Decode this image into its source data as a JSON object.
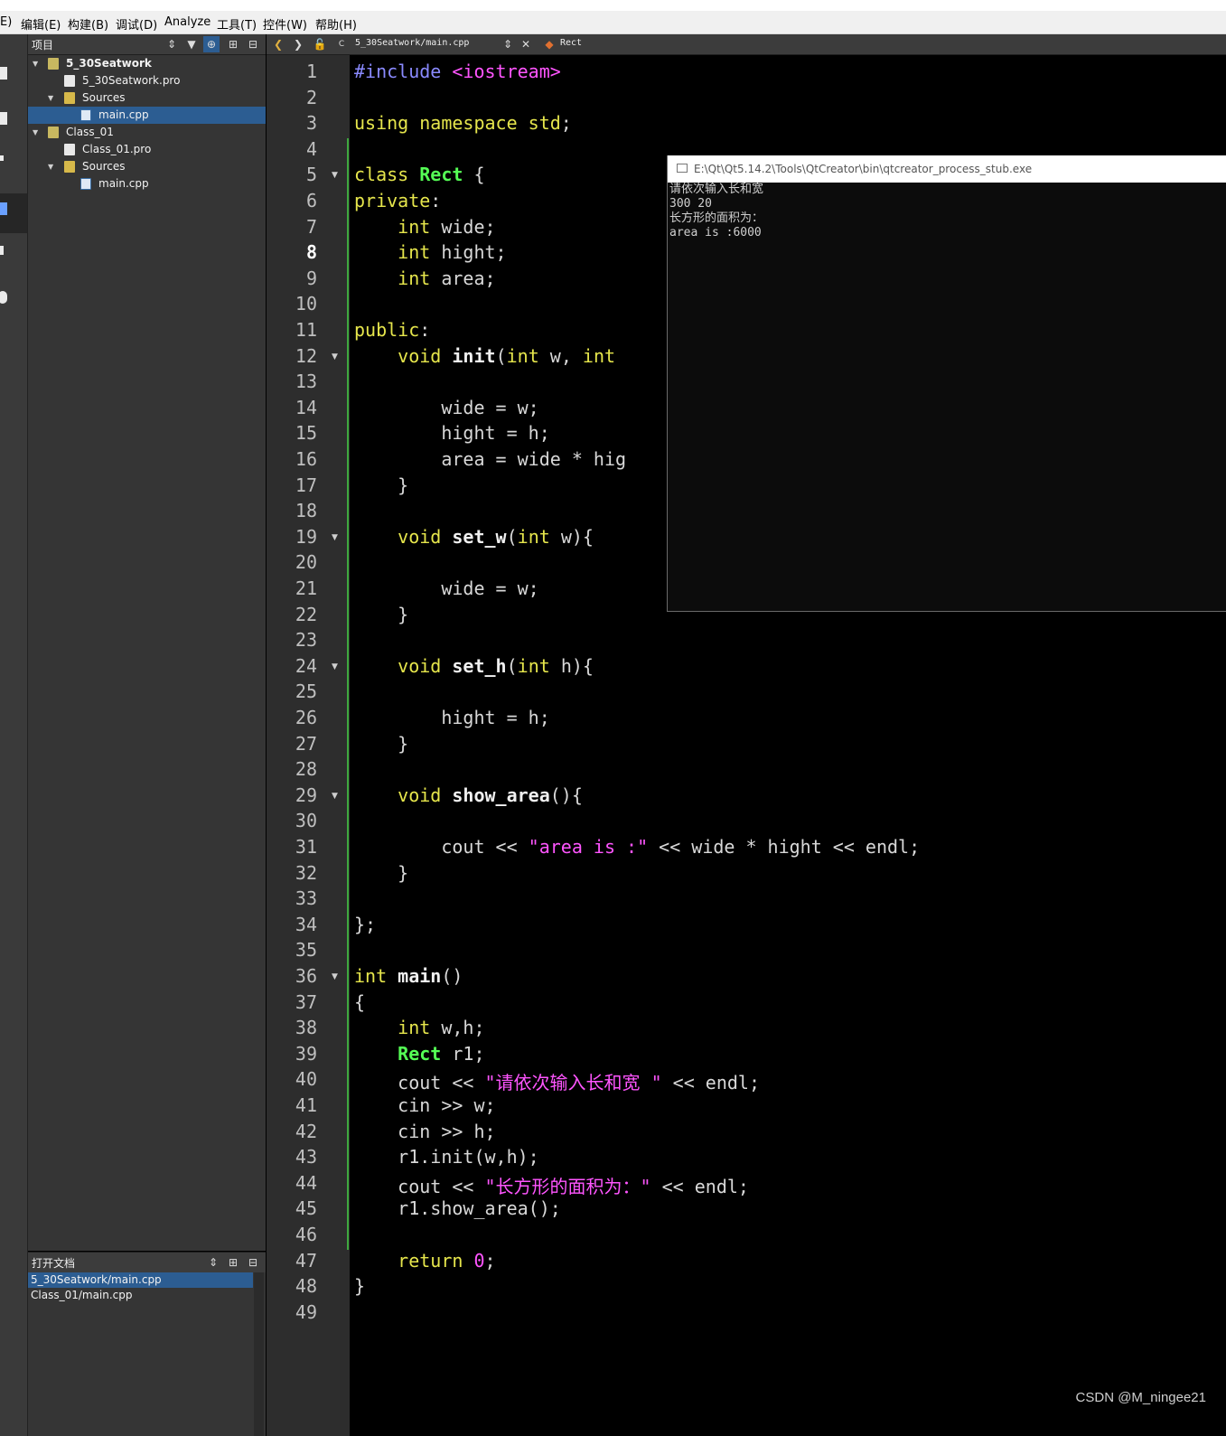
{
  "menu": [
    "编辑(E)",
    "构建(B)",
    "调试(D)",
    "Analyze",
    "工具(T)",
    "控件(W)",
    "帮助(H)"
  ],
  "menu_partial": "E)",
  "project_panel": {
    "title": "项目",
    "tree": [
      {
        "label": "5_30Seatwork",
        "kind": "project",
        "depth": 0,
        "expanded": true,
        "bold": true
      },
      {
        "label": "5_30Seatwork.pro",
        "kind": "pro",
        "depth": 1
      },
      {
        "label": "Sources",
        "kind": "folder",
        "depth": 1,
        "expanded": true
      },
      {
        "label": "main.cpp",
        "kind": "cpp",
        "depth": 2,
        "selected": true
      },
      {
        "label": "Class_01",
        "kind": "project",
        "depth": 0,
        "expanded": true
      },
      {
        "label": "Class_01.pro",
        "kind": "pro",
        "depth": 1
      },
      {
        "label": "Sources",
        "kind": "folder",
        "depth": 1,
        "expanded": true
      },
      {
        "label": "main.cpp",
        "kind": "cpp",
        "depth": 2
      }
    ]
  },
  "open_docs": {
    "title": "打开文档",
    "items": [
      {
        "label": "5_30Seatwork/main.cpp",
        "selected": true
      },
      {
        "label": "Class_01/main.cpp"
      }
    ]
  },
  "editor": {
    "file_combo": "5_30Seatwork/main.cpp",
    "symbol": "Rect",
    "current_line": 8,
    "lines": [
      [
        {
          "t": "#include ",
          "c": "pp"
        },
        {
          "t": "<iostream>",
          "c": "inc"
        }
      ],
      [],
      [
        {
          "t": "using ",
          "c": "kw"
        },
        {
          "t": "namespace ",
          "c": "kw"
        },
        {
          "t": "std",
          "c": "kw"
        },
        {
          "t": ";"
        }
      ],
      [],
      [
        {
          "t": "class ",
          "c": "kw"
        },
        {
          "t": "Rect",
          "c": "ty"
        },
        {
          "t": " {"
        }
      ],
      [
        {
          "t": "private",
          "c": "kw"
        },
        {
          "t": ":"
        }
      ],
      [
        {
          "t": "    "
        },
        {
          "t": "int",
          "c": "kw"
        },
        {
          "t": " wide;"
        }
      ],
      [
        {
          "t": "    "
        },
        {
          "t": "int",
          "c": "kw"
        },
        {
          "t": " hight;"
        }
      ],
      [
        {
          "t": "    "
        },
        {
          "t": "int",
          "c": "kw"
        },
        {
          "t": " area;"
        }
      ],
      [],
      [
        {
          "t": "public",
          "c": "kw"
        },
        {
          "t": ":"
        }
      ],
      [
        {
          "t": "    "
        },
        {
          "t": "void",
          "c": "kw"
        },
        {
          "t": " "
        },
        {
          "t": "init",
          "c": "fn"
        },
        {
          "t": "("
        },
        {
          "t": "int",
          "c": "kw"
        },
        {
          "t": " w, "
        },
        {
          "t": "int",
          "c": "kw"
        }
      ],
      [],
      [
        {
          "t": "        wide = w;"
        }
      ],
      [
        {
          "t": "        hight = h;"
        }
      ],
      [
        {
          "t": "        area = wide * hig"
        }
      ],
      [
        {
          "t": "    }"
        }
      ],
      [],
      [
        {
          "t": "    "
        },
        {
          "t": "void",
          "c": "kw"
        },
        {
          "t": " "
        },
        {
          "t": "set_w",
          "c": "fn"
        },
        {
          "t": "("
        },
        {
          "t": "int",
          "c": "kw"
        },
        {
          "t": " w){"
        }
      ],
      [],
      [
        {
          "t": "        wide = w;"
        }
      ],
      [
        {
          "t": "    }"
        }
      ],
      [],
      [
        {
          "t": "    "
        },
        {
          "t": "void",
          "c": "kw"
        },
        {
          "t": " "
        },
        {
          "t": "set_h",
          "c": "fn"
        },
        {
          "t": "("
        },
        {
          "t": "int",
          "c": "kw"
        },
        {
          "t": " h){"
        }
      ],
      [],
      [
        {
          "t": "        hight = h;"
        }
      ],
      [
        {
          "t": "    }"
        }
      ],
      [],
      [
        {
          "t": "    "
        },
        {
          "t": "void",
          "c": "kw"
        },
        {
          "t": " "
        },
        {
          "t": "show_area",
          "c": "fn"
        },
        {
          "t": "(){"
        }
      ],
      [],
      [
        {
          "t": "        cout << "
        },
        {
          "t": "\"area is :\"",
          "c": "st"
        },
        {
          "t": " << wide * hight << endl;"
        }
      ],
      [
        {
          "t": "    }"
        }
      ],
      [],
      [
        {
          "t": "};"
        }
      ],
      [],
      [
        {
          "t": "int",
          "c": "kw"
        },
        {
          "t": " "
        },
        {
          "t": "main",
          "c": "fn"
        },
        {
          "t": "()"
        }
      ],
      [
        {
          "t": "{"
        }
      ],
      [
        {
          "t": "    "
        },
        {
          "t": "int",
          "c": "kw"
        },
        {
          "t": " w,h;"
        }
      ],
      [
        {
          "t": "    "
        },
        {
          "t": "Rect",
          "c": "ty"
        },
        {
          "t": " r1;"
        }
      ],
      [
        {
          "t": "    cout << "
        },
        {
          "t": "\"请依次输入长和宽 \"",
          "c": "st"
        },
        {
          "t": " << endl;"
        }
      ],
      [
        {
          "t": "    cin >> w;"
        }
      ],
      [
        {
          "t": "    cin >> h;"
        }
      ],
      [
        {
          "t": "    r1.init(w,h);"
        }
      ],
      [
        {
          "t": "    cout << "
        },
        {
          "t": "\"长方形的面积为：\"",
          "c": "st"
        },
        {
          "t": " << endl;"
        }
      ],
      [
        {
          "t": "    r1.show_area();"
        }
      ],
      [],
      [
        {
          "t": "    "
        },
        {
          "t": "return",
          "c": "kw"
        },
        {
          "t": " "
        },
        {
          "t": "0",
          "c": "nm"
        },
        {
          "t": ";"
        }
      ],
      [
        {
          "t": "}"
        }
      ],
      []
    ]
  },
  "console": {
    "title": "E:\\Qt\\Qt5.14.2\\Tools\\QtCreator\\bin\\qtcreator_process_stub.exe",
    "lines": [
      "请依次输入长和宽",
      "300 20",
      "长方形的面积为：",
      "area is :6000"
    ]
  },
  "watermark": "CSDN @M_ningee21",
  "colors": {
    "background": "#000000",
    "sidebar": "#353535",
    "selection": "#2c5d92",
    "keyword": "#e6e64c",
    "type": "#55ff55",
    "string": "#ff55ff",
    "preprocessor": "#8a8aff"
  }
}
